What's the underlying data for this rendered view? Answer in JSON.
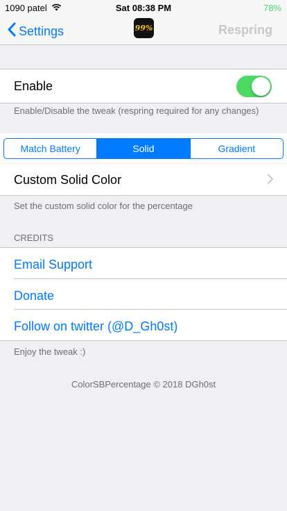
{
  "status_bar": {
    "carrier": "1090 patel",
    "time": "Sat 08:38 PM",
    "battery": "78%"
  },
  "nav": {
    "back_label": "Settings",
    "icon_text": "99%",
    "respring_label": "Respring"
  },
  "enable": {
    "label": "Enable",
    "on": true,
    "footer": "Enable/Disable the tweak (respring required for any changes)"
  },
  "segments": {
    "items": [
      "Match Battery",
      "Solid",
      "Gradient"
    ],
    "selected": "Solid"
  },
  "custom_color": {
    "label": "Custom Solid Color",
    "footer": "Set the custom solid color for the percentage"
  },
  "credits": {
    "header": "CREDITS",
    "items": [
      "Email Support",
      "Donate",
      "Follow on twitter (@D_Gh0st)"
    ],
    "footer": "Enjoy the tweak :)"
  },
  "copyright": "ColorSBPercentage © 2018 DGh0st",
  "colors": {
    "accent": "#007aff",
    "toggle_on": "#4cd964",
    "background": "#efeff4"
  }
}
